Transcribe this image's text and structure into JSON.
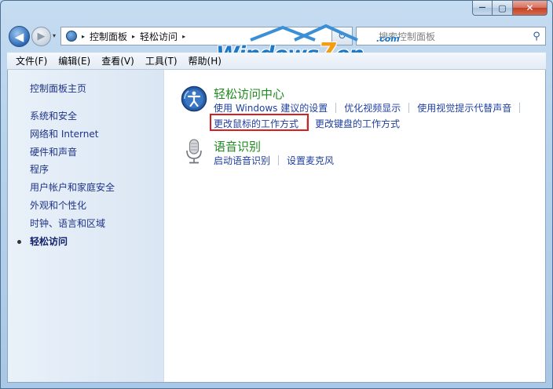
{
  "window": {
    "caption_min": "—",
    "caption_max": "▢",
    "caption_close": "✕"
  },
  "nav": {
    "back_glyph": "◀",
    "forward_glyph": "▶",
    "recent_glyph": "▾",
    "breadcrumb": [
      "控制面板",
      "轻松访问"
    ],
    "sep_glyph": "▸",
    "refresh_glyph": "↻",
    "search_placeholder": "搜索控制面板",
    "search_glyph": "⚲"
  },
  "watermark": {
    "text_a": "Windows",
    "text_b": "7",
    "text_c": "en",
    "com": ".com"
  },
  "menu": [
    "文件(F)",
    "编辑(E)",
    "查看(V)",
    "工具(T)",
    "帮助(H)"
  ],
  "sidebar": {
    "home": "控制面板主页",
    "items": [
      {
        "label": "系统和安全"
      },
      {
        "label": "网络和 Internet"
      },
      {
        "label": "硬件和声音"
      },
      {
        "label": "程序"
      },
      {
        "label": "用户帐户和家庭安全"
      },
      {
        "label": "外观和个性化"
      },
      {
        "label": "时钟、语言和区域"
      },
      {
        "label": "轻松访问"
      }
    ]
  },
  "categories": [
    {
      "title": "轻松访问中心",
      "icon": "ease-of-access-icon",
      "links_row1": [
        "使用 Windows 建议的设置",
        "优化视频显示",
        "使用视觉提示代替声音"
      ],
      "links_row2": [
        "更改鼠标的工作方式",
        "更改键盘的工作方式"
      ]
    },
    {
      "title": "语音识别",
      "icon": "microphone-icon",
      "links_row1": [
        "启动语音识别",
        "设置麦克风"
      ]
    }
  ],
  "colors": {
    "category_title": "#1e8a1e",
    "link": "#1e3fa0",
    "highlight": "#d81f1f"
  }
}
